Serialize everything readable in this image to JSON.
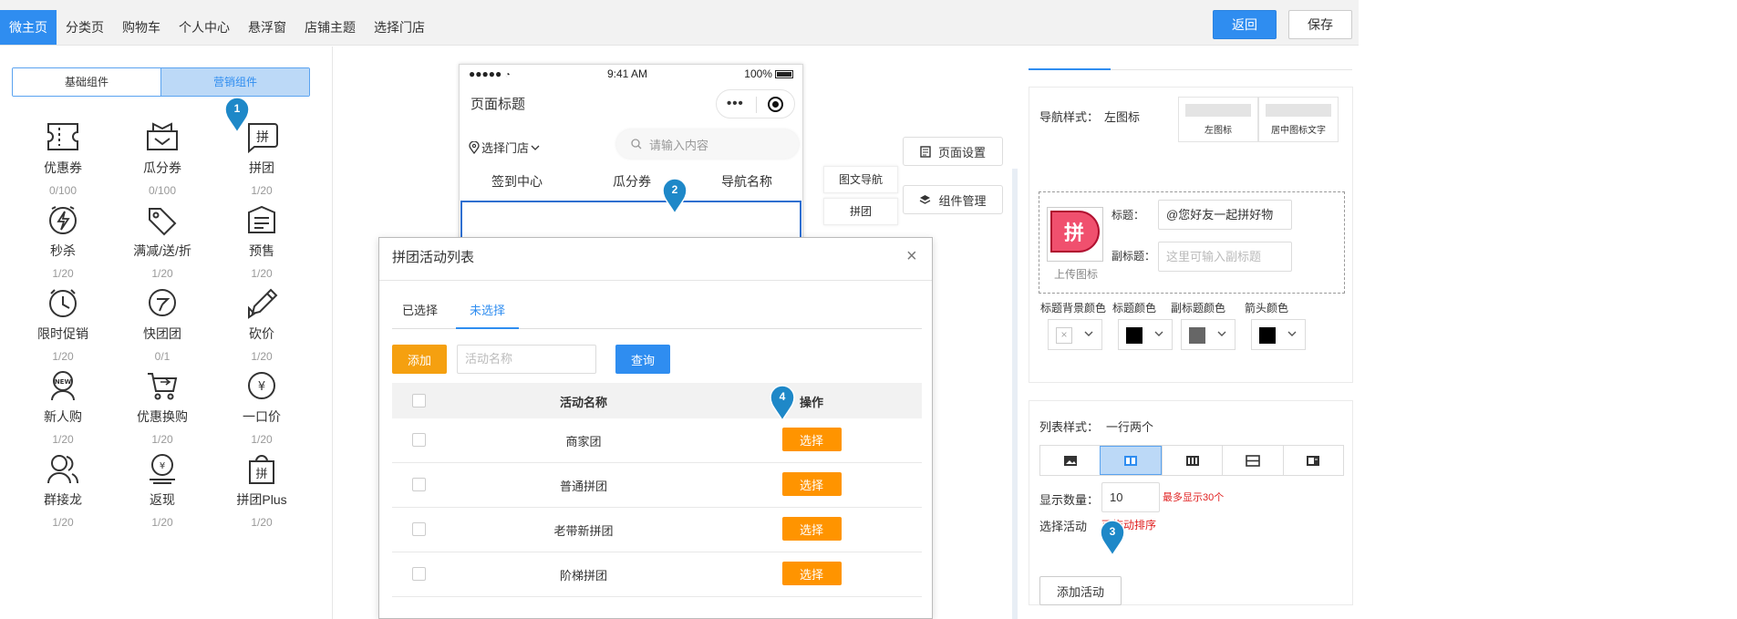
{
  "topnav": {
    "tabs": [
      {
        "label": "微主页",
        "active": true
      },
      {
        "label": "分类页"
      },
      {
        "label": "购物车"
      },
      {
        "label": "个人中心"
      },
      {
        "label": "悬浮窗"
      },
      {
        "label": "店铺主题"
      },
      {
        "label": "选择门店"
      }
    ],
    "back_label": "返回",
    "save_label": "保存"
  },
  "left": {
    "seg": {
      "basic": "基础组件",
      "marketing": "营销组件"
    },
    "components": [
      {
        "name": "优惠券",
        "count": "0/100",
        "icon": "coupon-icon"
      },
      {
        "name": "瓜分券",
        "count": "0/100",
        "icon": "split-coupon-icon"
      },
      {
        "name": "拼团",
        "count": "1/20",
        "icon": "group-buy-icon"
      },
      {
        "name": "秒杀",
        "count": "1/20",
        "icon": "flash-sale-icon"
      },
      {
        "name": "满减/送/折",
        "count": "1/20",
        "icon": "discount-tag-icon"
      },
      {
        "name": "预售",
        "count": "1/20",
        "icon": "presale-icon"
      },
      {
        "name": "限时促销",
        "count": "1/20",
        "icon": "timer-icon"
      },
      {
        "name": "快团团",
        "count": "0/1",
        "icon": "quick-group-icon"
      },
      {
        "name": "砍价",
        "count": "1/20",
        "icon": "bargain-icon"
      },
      {
        "name": "新人购",
        "count": "1/20",
        "icon": "new-user-icon"
      },
      {
        "name": "优惠换购",
        "count": "1/20",
        "icon": "exchange-cart-icon"
      },
      {
        "name": "一口价",
        "count": "1/20",
        "icon": "fixed-price-icon"
      },
      {
        "name": "群接龙",
        "count": "1/20",
        "icon": "group-chain-icon"
      },
      {
        "name": "返现",
        "count": "1/20",
        "icon": "cashback-icon"
      },
      {
        "name": "拼团Plus",
        "count": "1/20",
        "icon": "group-buy-plus-icon"
      }
    ]
  },
  "phone": {
    "status_left": "●●●●● ",
    "time": "9:41 AM",
    "battery": "100%",
    "page_title": "页面标题",
    "store_label": "选择门店",
    "search_placeholder": "请输入内容",
    "nav_items": [
      "签到中心",
      "瓜分券",
      "导航名称"
    ]
  },
  "tags": {
    "graphic_nav": "图文导航",
    "group_buy": "拼团"
  },
  "side_buttons": {
    "page_settings": "页面设置",
    "component_manage": "组件管理"
  },
  "settings": {
    "nav_style_label": "导航样式：",
    "nav_style_value": "左图标",
    "style_options": [
      "左图标",
      "居中图标文字"
    ],
    "upload_icon_label": "上传图标",
    "title_label": "标题：",
    "title_value": "@您好友一起拼好物",
    "subtitle_label": "副标题：",
    "subtitle_placeholder": "这里可输入副标题",
    "color_labels": [
      "标题背景颜色",
      "标题颜色",
      "副标题颜色",
      "箭头颜色"
    ],
    "color_values": [
      "#ffffff",
      "#000000",
      "#666666",
      "#000000"
    ],
    "list_style_label": "列表样式：",
    "list_style_value": "一行两个",
    "show_count_label": "显示数量：",
    "show_count_value": "10",
    "max_note": "最多显示30个",
    "select_activity_label": "选择活动",
    "drag_note": "可拖动排序",
    "add_activity": "添加活动"
  },
  "modal": {
    "title": "拼团活动列表",
    "close": "×",
    "tabs": [
      {
        "label": "已选择"
      },
      {
        "label": "未选择",
        "active": true
      }
    ],
    "add_label": "添加",
    "search_placeholder": "活动名称",
    "query_label": "查询",
    "columns": [
      "活动名称",
      "操作"
    ],
    "rows": [
      {
        "name": "商家团",
        "action": "选择"
      },
      {
        "name": "普通拼团",
        "action": "选择"
      },
      {
        "name": "老带新拼团",
        "action": "选择"
      },
      {
        "name": "阶梯拼团",
        "action": "选择"
      }
    ]
  },
  "markers": [
    "1",
    "2",
    "3",
    "4"
  ],
  "colors": {
    "primary": "#2f8df0",
    "orange": "#ff9400",
    "red": "#e02020"
  }
}
